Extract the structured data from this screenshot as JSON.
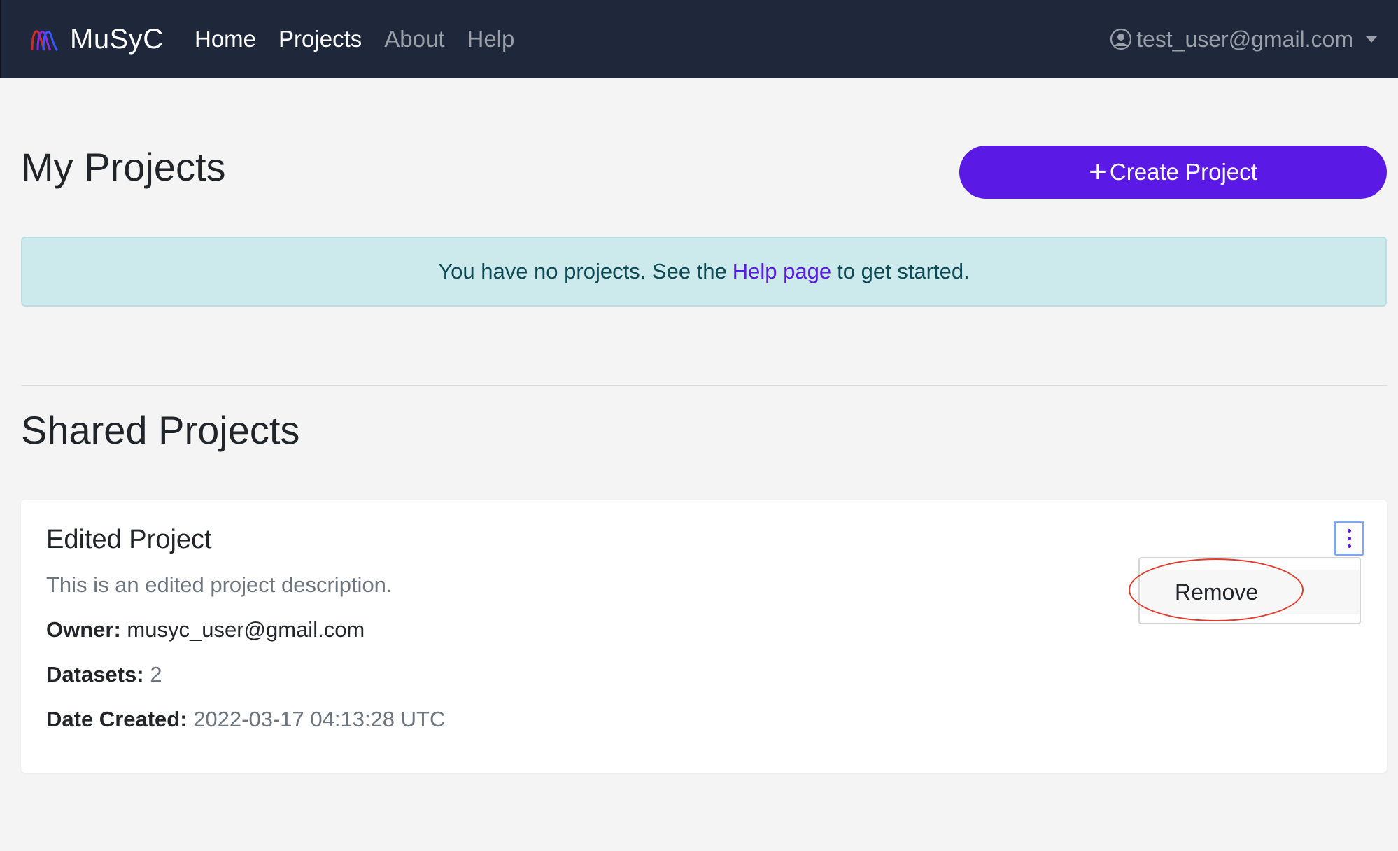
{
  "navbar": {
    "brand": "MuSyC",
    "links": [
      {
        "label": "Home",
        "active": true
      },
      {
        "label": "Projects",
        "active": true
      },
      {
        "label": "About",
        "active": false
      },
      {
        "label": "Help",
        "active": false
      }
    ],
    "user_email": "test_user@gmail.com"
  },
  "my_projects": {
    "title": "My Projects",
    "create_button_label": "Create Project",
    "empty_alert": {
      "before": "You have no projects. See the",
      "link": "Help page",
      "after": "to get started."
    }
  },
  "shared_projects": {
    "title": "Shared Projects",
    "cards": [
      {
        "name": "Edited Project",
        "description": "This is an edited project description.",
        "owner_label": "Owner:",
        "owner": "musyc_user@gmail.com",
        "datasets_label": "Datasets:",
        "datasets": "2",
        "date_label": "Date Created:",
        "date_created": "2022-03-17 04:13:28 UTC",
        "menu": {
          "items": [
            "Remove"
          ]
        }
      }
    ]
  },
  "colors": {
    "navbar_bg": "#1f273a",
    "accent": "#5a19e5",
    "alert_bg": "#cce9ec",
    "annotation_ring": "#e33b2d"
  },
  "icons": [
    "musyc-logo-icon",
    "user-circle-icon",
    "caret-down-icon",
    "plus-icon",
    "kebab-menu-icon"
  ]
}
